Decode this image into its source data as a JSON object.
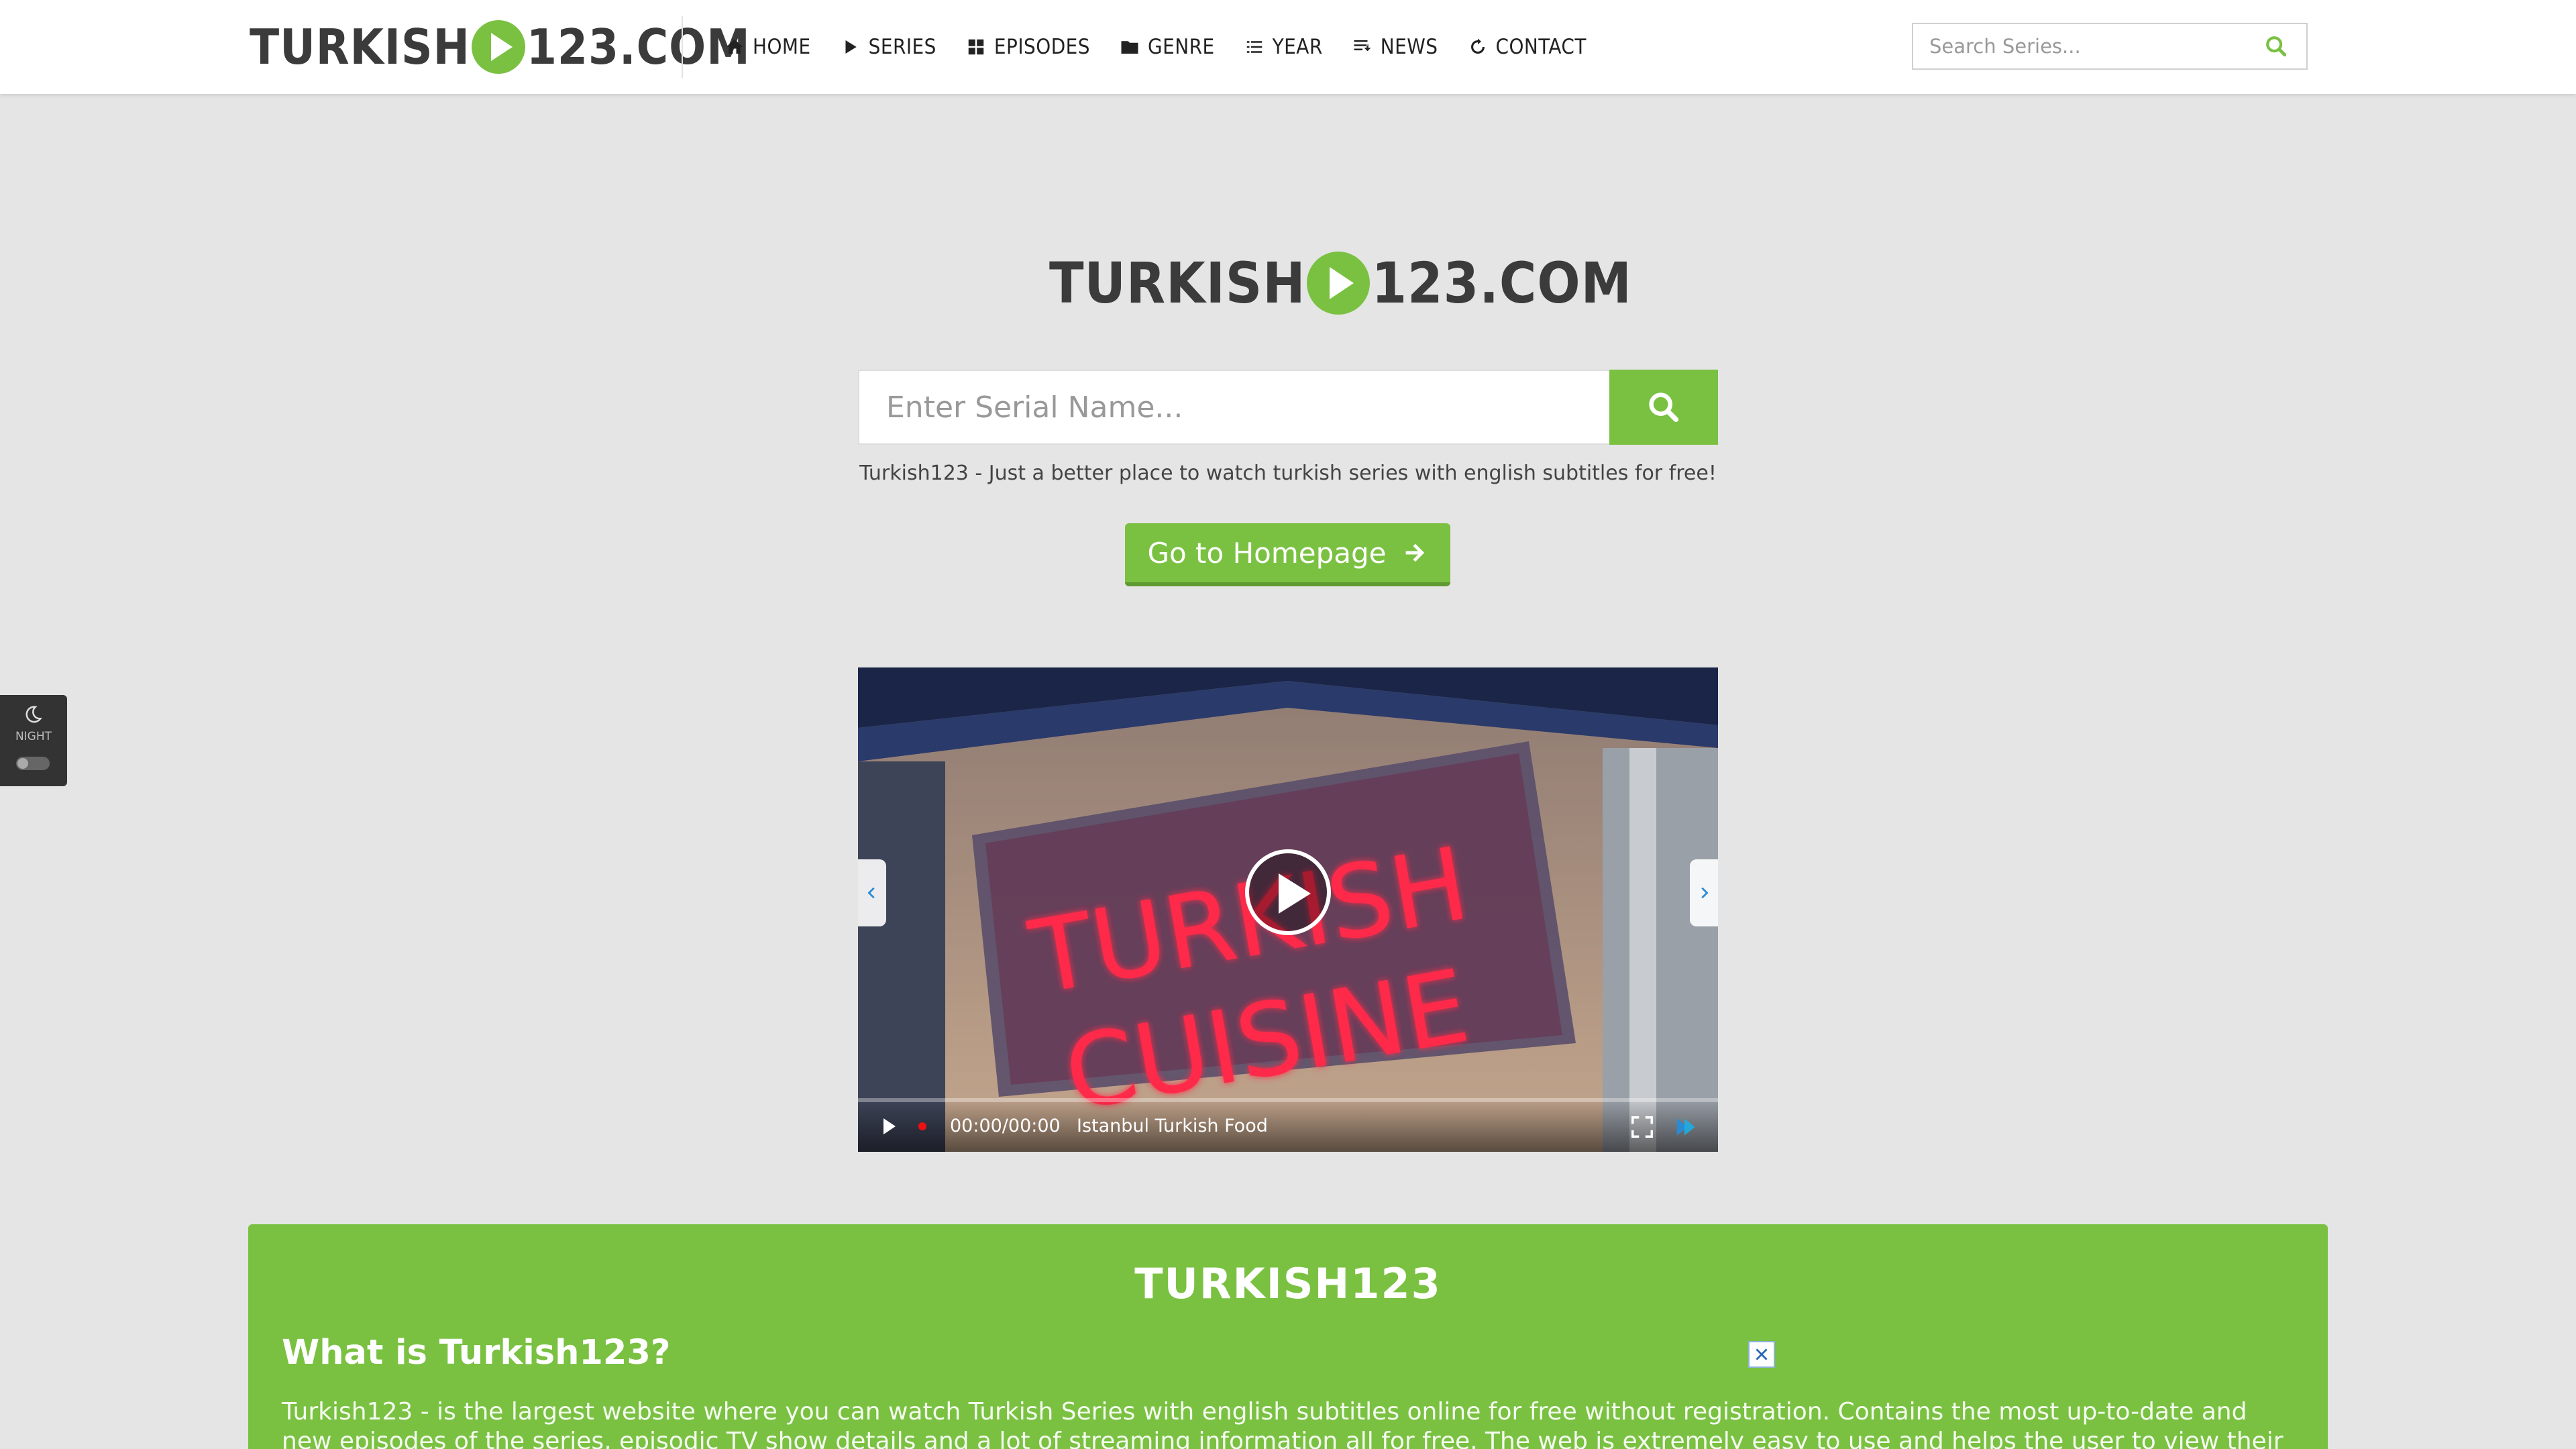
{
  "header": {
    "logo_left": "TURKISH",
    "logo_right": "123.COM",
    "nav": [
      {
        "label": "HOME",
        "icon": "home-icon"
      },
      {
        "label": "SERIES",
        "icon": "play-icon"
      },
      {
        "label": "EPISODES",
        "icon": "grid-icon"
      },
      {
        "label": "GENRE",
        "icon": "folder-icon"
      },
      {
        "label": "YEAR",
        "icon": "list-icon"
      },
      {
        "label": "NEWS",
        "icon": "news-icon"
      },
      {
        "label": "CONTACT",
        "icon": "refresh-icon"
      }
    ],
    "search_placeholder": "Search Series..."
  },
  "night_toggle": {
    "label": "NIGHT"
  },
  "hero": {
    "logo_left": "TURKISH",
    "logo_right": "123.COM",
    "search_placeholder": "Enter Serial Name...",
    "tagline": "Turkish123 - Just a better place to watch turkish series with english subtitles for free!",
    "home_button": "Go to Homepage"
  },
  "video": {
    "time": "00:00/00:00",
    "title": "Istanbul Turkish Food",
    "sign_line1": "TURKISH",
    "sign_line2": "CUISINE"
  },
  "info": {
    "title": "TURKISH123",
    "subtitle": "What is Turkish123?",
    "body": "Turkish123 - is the largest website where you can watch Turkish Series with english subtitles online for free without registration. Contains the most up-to-date and new episodes of the series, episodic TV show details and a lot of streaming information all for free. The web is extremely easy to use and helps the user to view their favorite series"
  },
  "colors": {
    "accent": "#7ac142",
    "header_bg": "#ffffff",
    "page_bg": "#e5e5e5"
  }
}
